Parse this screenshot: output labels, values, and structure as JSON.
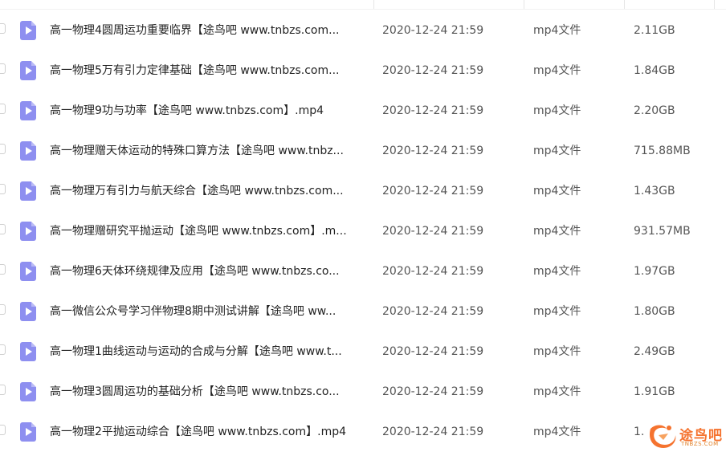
{
  "files": [
    {
      "name": "高一物理4圆周运功重要临界【途鸟吧 www.tnbzs.com...",
      "time": "2020-12-24 21:59",
      "type": "mp4文件",
      "size": "2.11GB"
    },
    {
      "name": "高一物理5万有引力定律基础【途鸟吧 www.tnbzs.com...",
      "time": "2020-12-24 21:59",
      "type": "mp4文件",
      "size": "1.84GB"
    },
    {
      "name": "高一物理9功与功率【途鸟吧 www.tnbzs.com】.mp4",
      "time": "2020-12-24 21:59",
      "type": "mp4文件",
      "size": "2.20GB"
    },
    {
      "name": "高一物理赠天体运动的特殊口算方法【途鸟吧 www.tnbz...",
      "time": "2020-12-24 21:59",
      "type": "mp4文件",
      "size": "715.88MB"
    },
    {
      "name": "高一物理万有引力与航天综合【途鸟吧 www.tnbzs.com...",
      "time": "2020-12-24 21:59",
      "type": "mp4文件",
      "size": "1.43GB"
    },
    {
      "name": "高一物理赠研究平抛运动【途鸟吧 www.tnbzs.com】.m...",
      "time": "2020-12-24 21:59",
      "type": "mp4文件",
      "size": "931.57MB"
    },
    {
      "name": "高一物理6天体环绕规律及应用【途鸟吧 www.tnbzs.co...",
      "time": "2020-12-24 21:59",
      "type": "mp4文件",
      "size": "1.97GB"
    },
    {
      "name": "高一微信公众号学习伴物理8期中测试讲解【途鸟吧 ww...",
      "time": "2020-12-24 21:59",
      "type": "mp4文件",
      "size": "1.80GB"
    },
    {
      "name": "高一物理1曲线运动与运动的合成与分解【途鸟吧 www.t...",
      "time": "2020-12-24 21:59",
      "type": "mp4文件",
      "size": "2.49GB"
    },
    {
      "name": "高一物理3圆周运功的基础分析【途鸟吧 www.tnbzs.co...",
      "time": "2020-12-24 21:59",
      "type": "mp4文件",
      "size": "1.91GB"
    },
    {
      "name": "高一物理2平抛运动综合【途鸟吧 www.tnbzs.com】.mp4",
      "time": "2020-12-24 21:59",
      "type": "mp4文件",
      "size": "1."
    }
  ],
  "watermark": {
    "text": "途鸟吧",
    "sub": "TNBZS.COM",
    "color": "#f5732f"
  }
}
